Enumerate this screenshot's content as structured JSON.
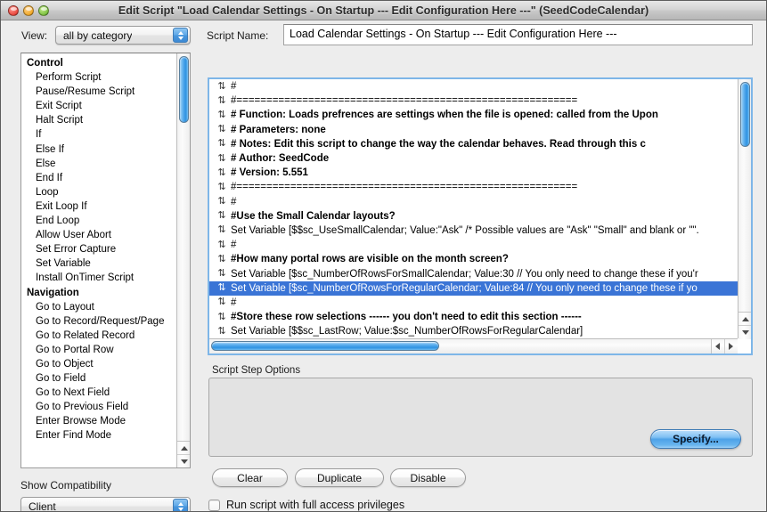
{
  "window": {
    "title": "Edit Script \"Load Calendar Settings - On Startup --- Edit Configuration Here ---\" (SeedCodeCalendar)",
    "close_icon": "close-icon",
    "minimize_icon": "minimize-icon",
    "zoom_icon": "zoom-icon"
  },
  "toolbar": {
    "view_label": "View:",
    "view_value": "all by category",
    "script_name_label": "Script Name:",
    "script_name_value": "Load Calendar Settings - On Startup --- Edit Configuration Here ---"
  },
  "steps_panel": {
    "items": [
      {
        "label": "Control",
        "type": "category"
      },
      {
        "label": "Perform Script",
        "type": "step"
      },
      {
        "label": "Pause/Resume Script",
        "type": "step"
      },
      {
        "label": "Exit Script",
        "type": "step"
      },
      {
        "label": "Halt Script",
        "type": "step"
      },
      {
        "label": "If",
        "type": "step"
      },
      {
        "label": "Else If",
        "type": "step"
      },
      {
        "label": "Else",
        "type": "step"
      },
      {
        "label": "End If",
        "type": "step"
      },
      {
        "label": "Loop",
        "type": "step"
      },
      {
        "label": "Exit Loop If",
        "type": "step"
      },
      {
        "label": "End Loop",
        "type": "step"
      },
      {
        "label": "Allow User Abort",
        "type": "step"
      },
      {
        "label": "Set Error Capture",
        "type": "step"
      },
      {
        "label": "Set Variable",
        "type": "step"
      },
      {
        "label": "Install OnTimer Script",
        "type": "step"
      },
      {
        "label": "Navigation",
        "type": "category"
      },
      {
        "label": "Go to Layout",
        "type": "step"
      },
      {
        "label": "Go to Record/Request/Page",
        "type": "step"
      },
      {
        "label": "Go to Related Record",
        "type": "step"
      },
      {
        "label": "Go to Portal Row",
        "type": "step"
      },
      {
        "label": "Go to Object",
        "type": "step"
      },
      {
        "label": "Go to Field",
        "type": "step"
      },
      {
        "label": "Go to Next Field",
        "type": "step"
      },
      {
        "label": "Go to Previous Field",
        "type": "step"
      },
      {
        "label": "Enter Browse Mode",
        "type": "step"
      },
      {
        "label": "Enter Find Mode",
        "type": "step"
      }
    ]
  },
  "compatibility": {
    "label": "Show Compatibility",
    "value": "Client"
  },
  "script_editor": {
    "grip_icon": "reorder-grip-icon",
    "lines": [
      {
        "text": "#",
        "bold": false,
        "selected": false
      },
      {
        "text": "#=========================================================",
        "bold": false,
        "selected": false
      },
      {
        "text": "#   Function:            Loads prefrences are settings when the file is opened: called from the Upon",
        "bold": true,
        "selected": false
      },
      {
        "text": "#   Parameters:        none",
        "bold": true,
        "selected": false
      },
      {
        "text": "#   Notes:                 Edit this script to change the way the calendar behaves. Read through this c",
        "bold": true,
        "selected": false
      },
      {
        "text": "#   Author:                SeedCode",
        "bold": true,
        "selected": false
      },
      {
        "text": "#   Version:               5.551",
        "bold": true,
        "selected": false
      },
      {
        "text": "#=========================================================",
        "bold": false,
        "selected": false
      },
      {
        "text": "#",
        "bold": false,
        "selected": false
      },
      {
        "text": "#Use the Small Calendar layouts?",
        "bold": true,
        "selected": false
      },
      {
        "text": "Set Variable [$$sc_UseSmallCalendar; Value:\"Ask\"  /*  Possible values are \"Ask\" \"Small\" and blank or \"\".",
        "bold": false,
        "selected": false
      },
      {
        "text": "#",
        "bold": false,
        "selected": false
      },
      {
        "text": "#How many portal rows are visible on the month screen?",
        "bold": true,
        "selected": false
      },
      {
        "text": "Set Variable [$sc_NumberOfRowsForSmallCalendar; Value:30  // You only need to change these if you'r",
        "bold": false,
        "selected": false
      },
      {
        "text": "Set Variable [$sc_NumberOfRowsForRegularCalendar; Value:84  // You only need to change these if yo",
        "bold": false,
        "selected": true
      },
      {
        "text": "#",
        "bold": false,
        "selected": false
      },
      {
        "text": "#Store these row selections ------ you don't need to edit this section ------",
        "bold": true,
        "selected": false
      },
      {
        "text": "Set Variable [$$sc_LastRow; Value:$sc_NumberOfRowsForRegularCalendar]",
        "bold": false,
        "selected": false
      }
    ]
  },
  "options": {
    "label": "Script Step Options",
    "specify_label": "Specify..."
  },
  "buttons": {
    "clear": "Clear",
    "duplicate": "Duplicate",
    "disable": "Disable"
  },
  "full_access": {
    "label": "Run script with full access privileges",
    "checked": false
  },
  "colors": {
    "selection_blue": "#3a74d6",
    "accent_blue": "#4ea2e8",
    "window_bg": "#ededed",
    "field_bg": "#ffffff"
  }
}
